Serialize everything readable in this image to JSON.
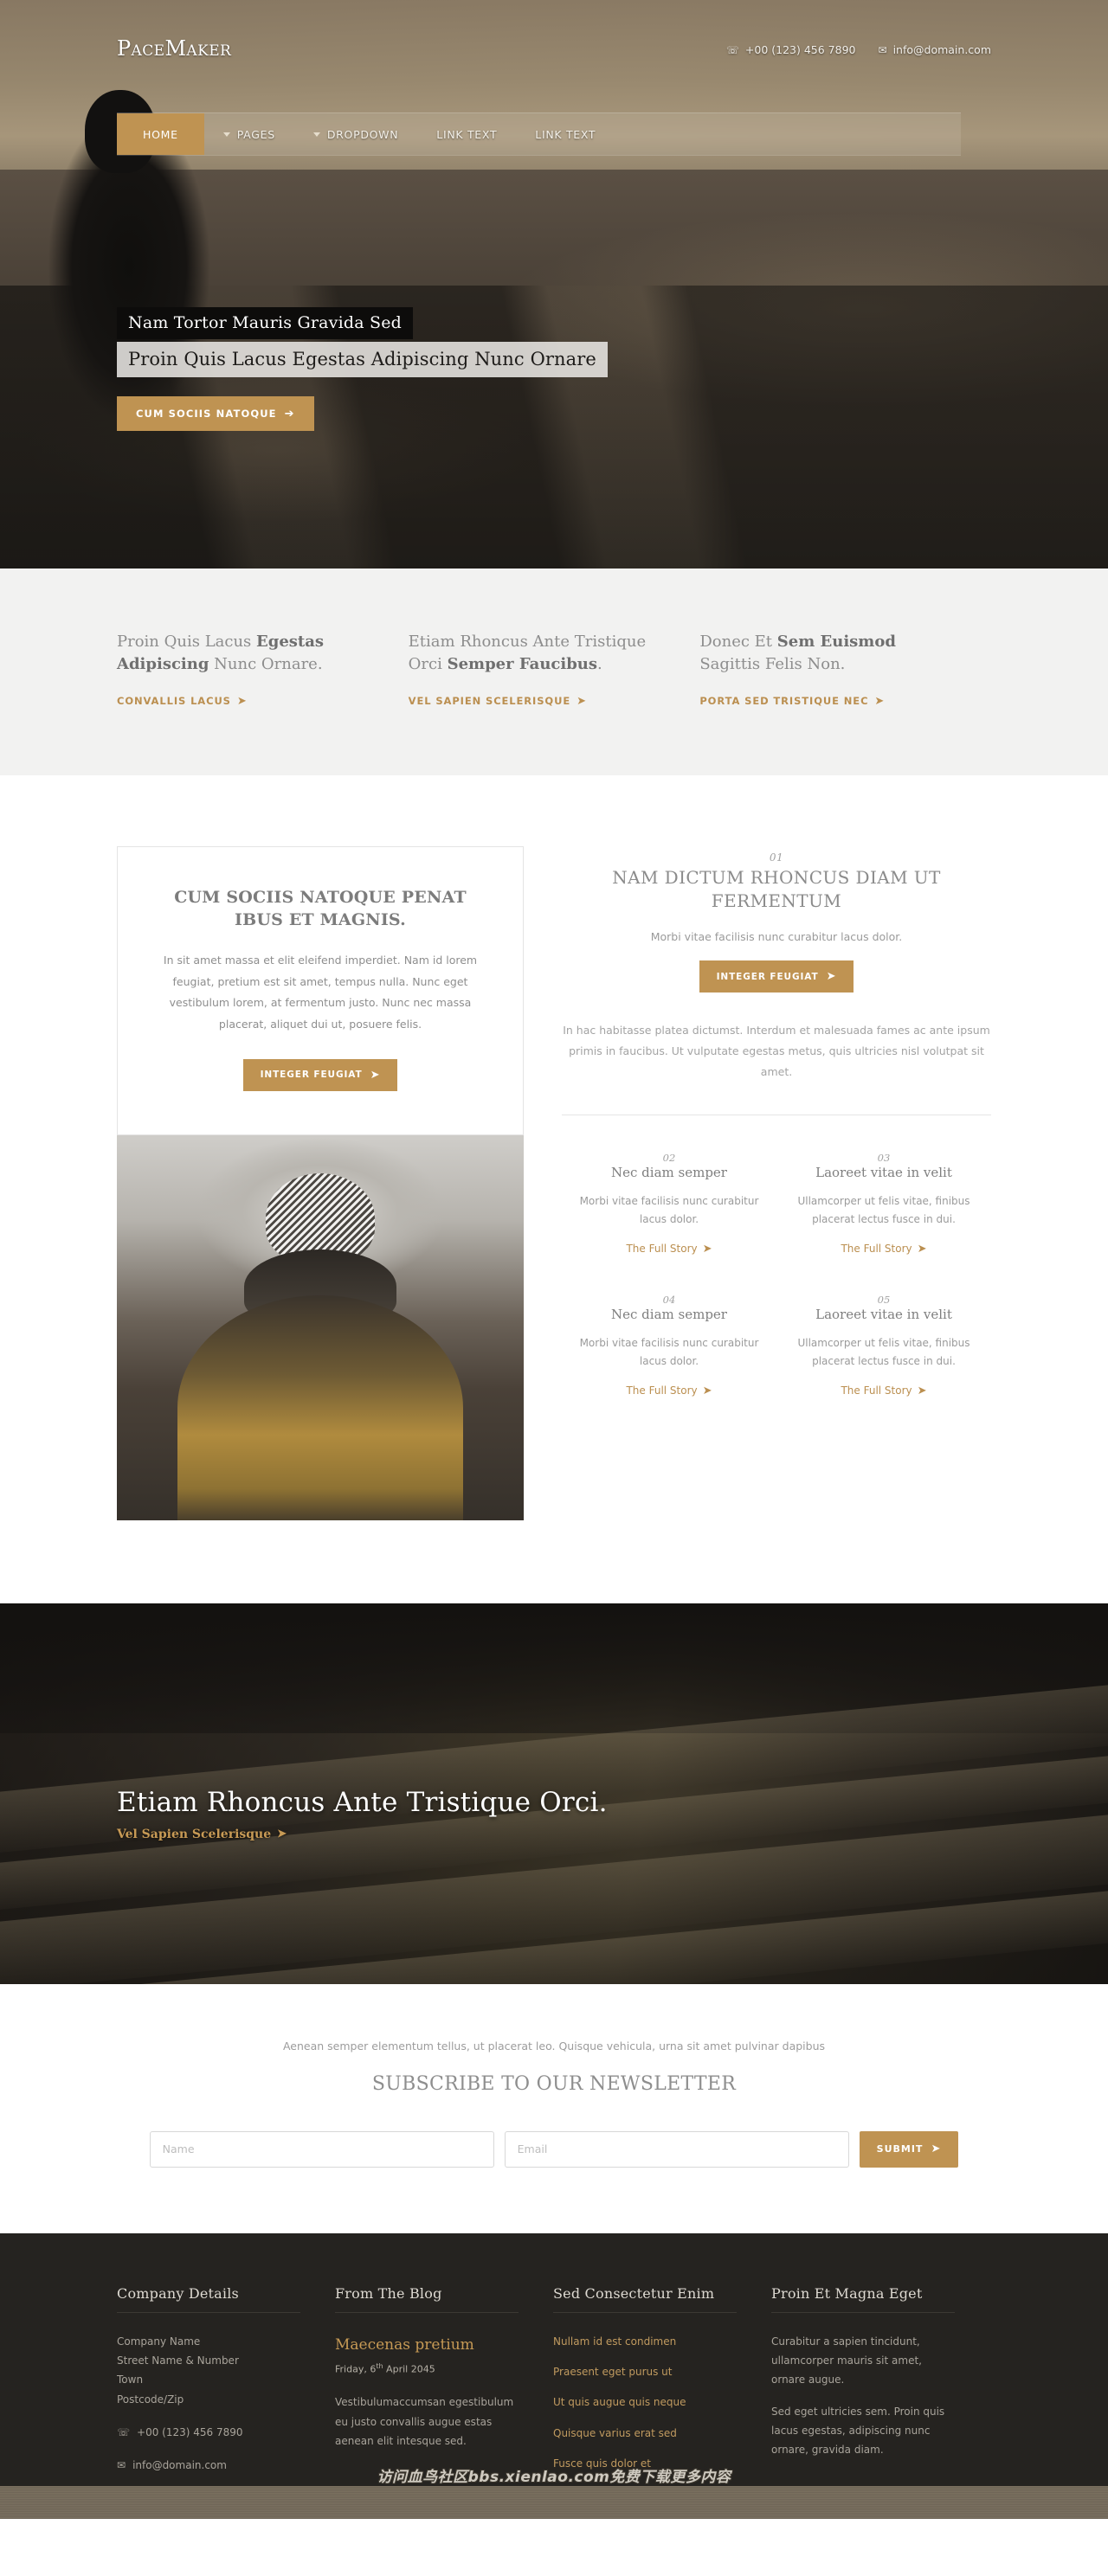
{
  "colors": {
    "gold": "#bf9352",
    "dark": "#252320",
    "band": "#f2f2f1",
    "muted": "#8e8e8e"
  },
  "header": {
    "logo": "PaceMaker",
    "phone": "+00 (123) 456 7890",
    "email": "info@domain.com",
    "phone_icon": "phone-icon",
    "email_icon": "envelope-icon"
  },
  "nav": {
    "items": [
      {
        "label": "HOME",
        "active": true,
        "caret": false
      },
      {
        "label": "PAGES",
        "active": false,
        "caret": true
      },
      {
        "label": "DROPDOWN",
        "active": false,
        "caret": true
      },
      {
        "label": "LINK TEXT",
        "active": false,
        "caret": false
      },
      {
        "label": "LINK TEXT",
        "active": false,
        "caret": false
      }
    ]
  },
  "hero": {
    "caption_1": "Nam Tortor Mauris Gravida Sed",
    "caption_2": "Proin Quis Lacus Egestas Adipiscing Nunc Ornare",
    "cta": "CUM SOCIIS NATOQUE",
    "cta_arrow": "➔"
  },
  "intro": {
    "columns": [
      {
        "text_a": "Proin Quis Lacus ",
        "bold_a": "Egestas Adipiscing",
        "text_b": " Nunc Ornare.",
        "link": "CONVALLIS LACUS"
      },
      {
        "text_a": "Etiam Rhoncus Ante Tristique Orci ",
        "bold_a": "Semper Faucibus",
        "text_b": ".",
        "link": "VEL SAPIEN SCELERISQUE"
      },
      {
        "text_a": "Donec Et ",
        "bold_a": "Sem Euismod",
        "text_b": " Sagittis Felis Non.",
        "link": "PORTA SED TRISTIQUE NEC"
      }
    ]
  },
  "card": {
    "title": "CUM SOCIIS NATOQUE PENAT IBUS ET MAGNIS.",
    "body": "In sit amet massa et elit eleifend imperdiet. Nam id lorem feugiat, pretium est sit amet, tempus nulla. Nunc eget vestibulum lorem, at fermentum justo. Nunc nec massa placerat, aliquet dui ut, posuere felis.",
    "cta": "INTEGER FEUGIAT",
    "image_alt": "person-in-beanie-photo"
  },
  "feature": {
    "number": "01",
    "title": "NAM DICTUM RHONCUS DIAM UT FERMENTUM",
    "lead": "Morbi vitae facilisis nunc curabitur lacus dolor.",
    "cta": "INTEGER FEUGIAT",
    "paragraph": "In hac habitasse platea dictumst. Interdum et malesuada fames ac ante ipsum primis in faucibus. Ut vulputate egestas metus, quis ultricies nisl volutpat sit amet."
  },
  "features_grid": [
    {
      "number": "02",
      "title": "Nec diam semper",
      "text": "Morbi vitae facilisis nunc curabitur lacus dolor.",
      "link": "The Full Story"
    },
    {
      "number": "03",
      "title": "Laoreet vitae in velit",
      "text": "Ullamcorper ut felis vitae, finibus placerat lectus fusce in dui.",
      "link": "The Full Story"
    },
    {
      "number": "04",
      "title": "Nec diam semper",
      "text": "Morbi vitae facilisis nunc curabitur lacus dolor.",
      "link": "The Full Story"
    },
    {
      "number": "05",
      "title": "Laoreet vitae in velit",
      "text": "Ullamcorper ut felis vitae, finibus placerat lectus fusce in dui.",
      "link": "The Full Story"
    }
  ],
  "banner": {
    "title": "Etiam Rhoncus Ante Tristique Orci.",
    "link": "Vel Sapien Scelerisque"
  },
  "newsletter": {
    "blurb": "Aenean semper elementum tellus, ut placerat leo. Quisque vehicula, urna sit amet pulvinar dapibus",
    "heading": "SUBSCRIBE TO OUR NEWSLETTER",
    "name_placeholder": "Name",
    "email_placeholder": "Email",
    "name_value": "",
    "email_value": "",
    "submit": "SUBMIT"
  },
  "footer": {
    "col1": {
      "heading": "Company Details",
      "line1": "Company Name",
      "line2": "Street Name & Number",
      "line3": "Town",
      "line4": "Postcode/Zip",
      "phone": "+00 (123) 456 7890",
      "email": "info@domain.com"
    },
    "col2": {
      "heading": "From The Blog",
      "post_title": "Maecenas pretium",
      "date_pre": "Friday, 6",
      "date_sup": "th",
      "date_post": " April 2045",
      "excerpt": "Vestibulumaccumsan egestibulum eu justo convallis augue estas aenean elit intesque sed."
    },
    "col3": {
      "heading": "Sed Consectetur Enim",
      "links": [
        "Nullam id est condimen",
        "Praesent eget purus ut",
        "Ut quis augue quis neque",
        "Quisque varius erat sed",
        "Fusce quis dolor et"
      ]
    },
    "col4": {
      "heading": "Proin Et Magna Eget",
      "p1": "Curabitur a sapien tincidunt, ullamcorper mauris sit amet, ornare augue.",
      "p2": "Sed eget ultricies sem. Proin quis lacus egestas, adipiscing nunc ornare, gravida diam."
    }
  },
  "watermark": {
    "text": "访问血鸟社区bbs.xienlao.com免费下载更多内容"
  }
}
